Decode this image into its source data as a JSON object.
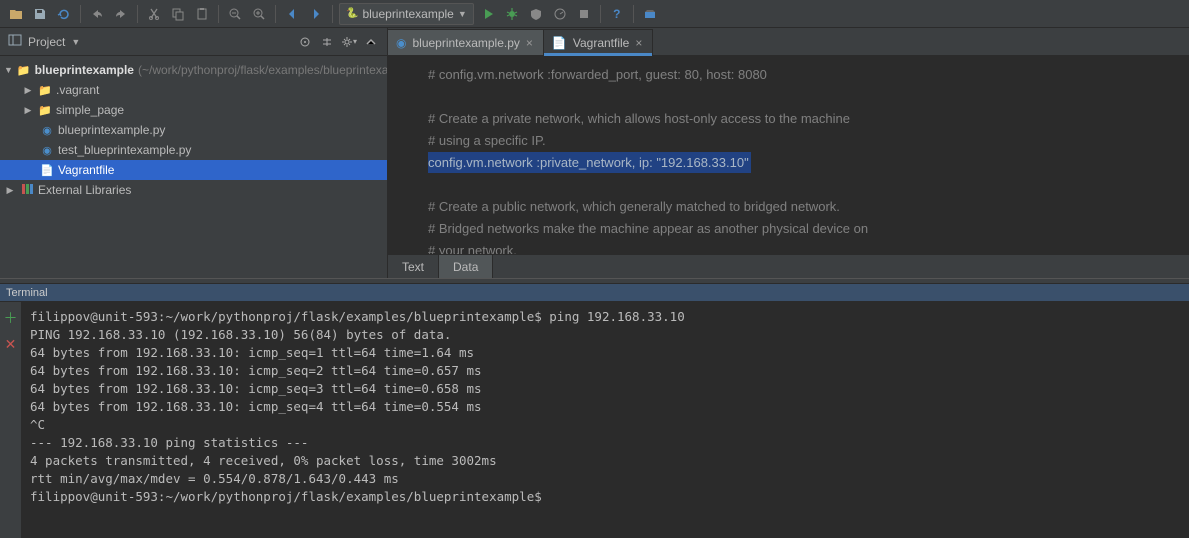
{
  "runConfig": "blueprintexample",
  "projectLabel": "Project",
  "projectRoot": {
    "name": "blueprintexample",
    "path": "(~/work/pythonproj/flask/examples/blueprintexample)"
  },
  "tree": {
    "vagrant": ".vagrant",
    "simple_page": "simple_page",
    "bp_py": "blueprintexample.py",
    "test_py": "test_blueprintexample.py",
    "vagrantfile": "Vagrantfile",
    "ext_lib": "External Libraries"
  },
  "tabs": {
    "t1": "blueprintexample.py",
    "t2": "Vagrantfile"
  },
  "code": {
    "l1": "# config.vm.network :forwarded_port, guest: 80, host: 8080",
    "l2": "",
    "l3": "# Create a private network, which allows host-only access to the machine",
    "l4": "# using a specific IP.",
    "l5": "config.vm.network :private_network, ip: \"192.168.33.10\"",
    "l6": "",
    "l7": "# Create a public network, which generally matched to bridged network.",
    "l8": "# Bridged networks make the machine appear as another physical device on",
    "l9": "# your network."
  },
  "subtabs": {
    "text": "Text",
    "data": "Data"
  },
  "terminal": {
    "title": "Terminal",
    "lines": [
      "filippov@unit-593:~/work/pythonproj/flask/examples/blueprintexample$ ping 192.168.33.10",
      "PING 192.168.33.10 (192.168.33.10) 56(84) bytes of data.",
      "64 bytes from 192.168.33.10: icmp_seq=1 ttl=64 time=1.64 ms",
      "64 bytes from 192.168.33.10: icmp_seq=2 ttl=64 time=0.657 ms",
      "64 bytes from 192.168.33.10: icmp_seq=3 ttl=64 time=0.658 ms",
      "64 bytes from 192.168.33.10: icmp_seq=4 ttl=64 time=0.554 ms",
      "^C",
      "--- 192.168.33.10 ping statistics ---",
      "4 packets transmitted, 4 received, 0% packet loss, time 3002ms",
      "rtt min/avg/max/mdev = 0.554/0.878/1.643/0.443 ms",
      "filippov@unit-593:~/work/pythonproj/flask/examples/blueprintexample$"
    ]
  }
}
